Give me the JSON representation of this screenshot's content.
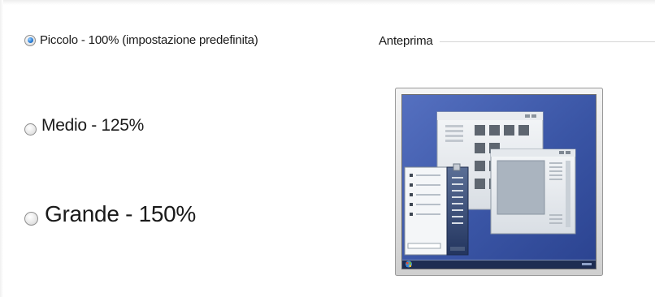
{
  "dpi_options": [
    {
      "label": "Piccolo - 100% (impostazione predefinita)",
      "checked": true
    },
    {
      "label": "Medio - 125%",
      "checked": false
    },
    {
      "label": "Grande - 150%",
      "checked": false
    }
  ],
  "preview": {
    "title": "Anteprima",
    "image_icon": "desktop-preview-icon"
  },
  "colors": {
    "desktop_background": "#3f5aa8",
    "window_frame": "#dfe3e8",
    "radio_selected": "#2a7fd6",
    "separator": "#d6d6d6"
  }
}
